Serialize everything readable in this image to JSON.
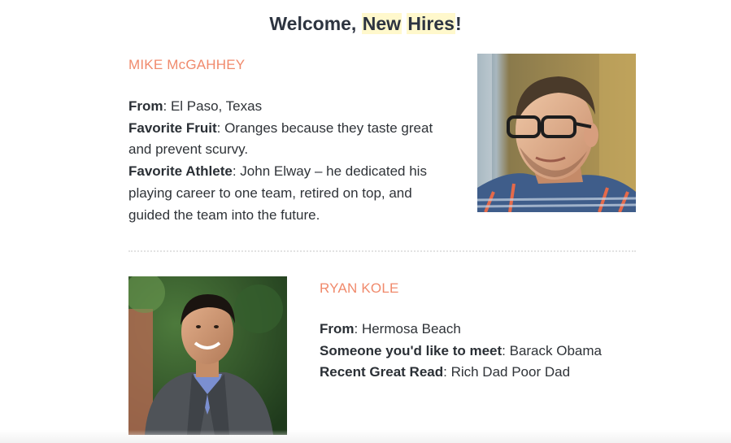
{
  "header": {
    "prefix": "Welcome, ",
    "word1": "New",
    "word2": "Hires",
    "suffix": "!"
  },
  "hires": [
    {
      "name": "MIKE McGAHHEY",
      "facts": [
        {
          "label": "From",
          "value": ": El Paso, Texas"
        },
        {
          "label": "Favorite Fruit",
          "value": ": Oranges because they taste great and prevent scurvy."
        },
        {
          "label": "Favorite Athlete",
          "value": ": John Elway – he dedicated his playing career to one team, retired on top, and guided the team into the future."
        }
      ]
    },
    {
      "name": "RYAN KOLE",
      "facts": [
        {
          "label": "From",
          "value": ": Hermosa Beach"
        },
        {
          "label": "Someone you'd like to meet",
          "value": ": Barack Obama"
        },
        {
          "label": "Recent Great Read",
          "value": ": Rich Dad Poor Dad"
        }
      ]
    }
  ],
  "colors": {
    "name_accent": "#f08a6c",
    "highlight": "#fff8cc",
    "text": "#2f3338"
  }
}
